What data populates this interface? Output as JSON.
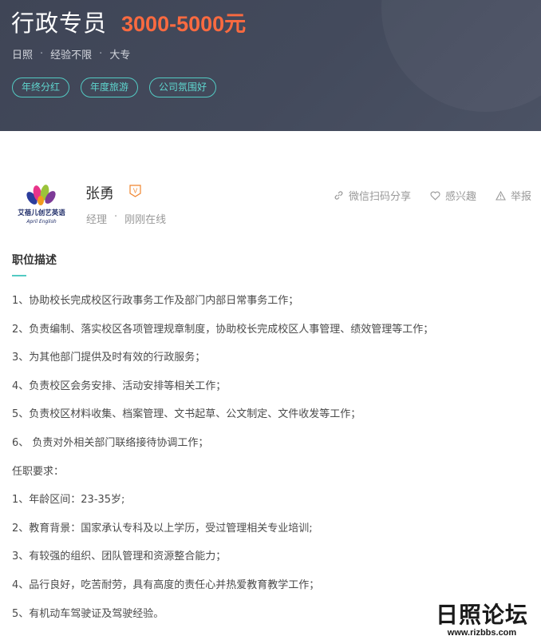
{
  "header": {
    "title": "行政专员",
    "salary": "3000-5000元",
    "meta": [
      "日照",
      "经验不限",
      "大专"
    ],
    "meta_separator": "·",
    "tags": [
      "年终分红",
      "年度旅游",
      "公司氛围好"
    ],
    "colors": {
      "background": "#434a5c",
      "salary": "#fa6a40",
      "tag": "#53cac3"
    }
  },
  "company": {
    "logo_name_cn": "艾蓓儿创艺英语",
    "logo_name_en": "April English",
    "logo_icon": "flower-logo-icon"
  },
  "recruiter": {
    "name": "张勇",
    "badge": "V",
    "role": "经理",
    "status": "刚刚在线",
    "separator": "·"
  },
  "actions": [
    {
      "label": "微信扫码分享",
      "icon": "link-icon"
    },
    {
      "label": "感兴趣",
      "icon": "heart-icon"
    },
    {
      "label": "举报",
      "icon": "warning-icon"
    }
  ],
  "description": {
    "title": "职位描述",
    "lines": [
      "1、协助校长完成校区行政事务工作及部门内部日常事务工作；",
      "2、负责编制、落实校区各项管理规章制度，协助校长完成校区人事管理、绩效管理等工作；",
      "3、为其他部门提供及时有效的行政服务；",
      "4、负责校区会务安排、活动安排等相关工作；",
      "5、负责校区材料收集、档案管理、文书起草、公文制定、文件收发等工作；",
      "6、 负责对外相关部门联络接待协调工作；",
      "任职要求：",
      "1、年龄区间：23-35岁;",
      "2、教育背景：国家承认专科及以上学历，受过管理相关专业培训;",
      "3、有较强的组织、团队管理和资源整合能力；",
      "4、品行良好，吃苦耐劳，具有高度的责任心并热爱教育教学工作；",
      "5、有机动车驾驶证及驾驶经验。"
    ]
  },
  "watermark": {
    "name": "日照论坛",
    "url": "www.rizbbs.com"
  }
}
